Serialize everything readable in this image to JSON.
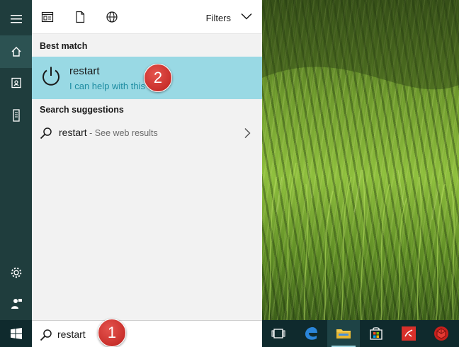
{
  "filters": {
    "label": "Filters"
  },
  "best_match": {
    "heading": "Best match",
    "title": "restart",
    "subtitle": "I can help with this"
  },
  "suggestions": {
    "heading": "Search suggestions",
    "item": {
      "query": "restart",
      "hint": " - See web results"
    }
  },
  "search": {
    "value": "restart"
  },
  "annotations": {
    "badge1": "1",
    "badge2": "2"
  },
  "icons": {
    "rail": [
      "hamburger-icon",
      "home-icon",
      "notebook-icon",
      "device-icon",
      "settings-icon",
      "feedback-icon"
    ],
    "filters": [
      "apps-filter-icon",
      "documents-filter-icon",
      "web-filter-icon"
    ],
    "taskbar": [
      "start-icon",
      "search-icon",
      "task-view-icon",
      "edge-icon",
      "file-explorer-icon",
      "store-icon",
      "app-red-icon",
      "app-cube-icon"
    ]
  },
  "colors": {
    "accent": "#99d9e4",
    "link": "#1b8ba0",
    "rail": "#1f3d3d",
    "taskbar": "#0f2a2d",
    "badge": "#c9302c"
  }
}
